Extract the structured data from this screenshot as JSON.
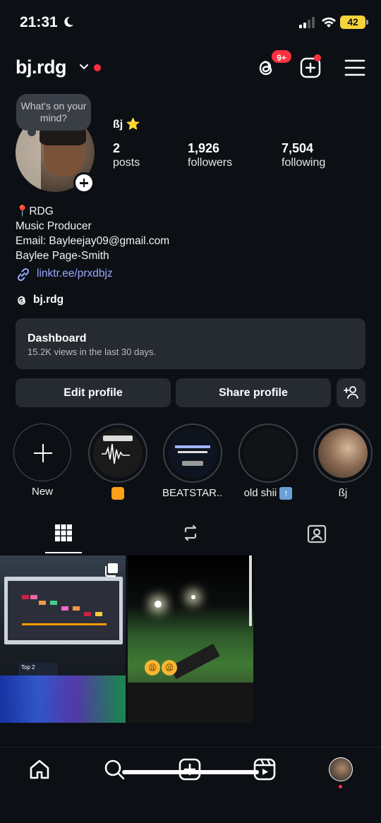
{
  "status_bar": {
    "time": "21:31",
    "battery": "42"
  },
  "header": {
    "username": "bj.rdg",
    "threads_badge": "9+"
  },
  "profile": {
    "note": "What's on your mind?",
    "display_name": "ßj",
    "display_emoji": "⭐",
    "stats": [
      {
        "value": "2",
        "label": "posts"
      },
      {
        "value": "1,926",
        "label": "followers"
      },
      {
        "value": "7,504",
        "label": "following"
      }
    ],
    "bio_lines": [
      "RDG",
      "Music Producer",
      "Email: Bayleejay09@gmail.com",
      "Baylee Page-Smith"
    ],
    "bio_pin": "📍",
    "link": "linktr.ee/prxdbjz",
    "threads_handle": "bj.rdg"
  },
  "dashboard": {
    "title": "Dashboard",
    "subtitle": "15.2K views in the last 30 days."
  },
  "buttons": {
    "edit": "Edit profile",
    "share": "Share profile"
  },
  "highlights": [
    {
      "label": "New"
    },
    {
      "label": ""
    },
    {
      "label": "BEATSTAR..."
    },
    {
      "label": "old shii"
    },
    {
      "label": "ßj"
    }
  ],
  "posts": [
    {
      "badge_text": "Top 2"
    },
    {
      "emojis": "😫 😫"
    }
  ],
  "colors": {
    "accent_red": "#ff3040",
    "link_blue": "#9aa8ff",
    "card_bg": "#262a31"
  }
}
